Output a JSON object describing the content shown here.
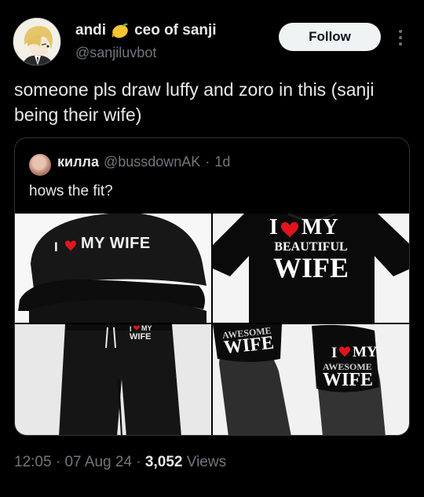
{
  "author": {
    "display_name": "andi",
    "name_suffix": "ceo of sanji",
    "handle": "@sanjiluvbot",
    "emoji": "lemon-icon"
  },
  "follow_label": "Follow",
  "tweet_text": "someone pls draw luffy and zoro in this (sanji being their wife)",
  "quote": {
    "display_name": "килла",
    "handle": "@bussdownAK",
    "separator": "·",
    "time": "1d",
    "text": "hows the fit?",
    "images": {
      "cap": {
        "line1": "MY WIFE"
      },
      "tshirt": {
        "line1": "MY",
        "line2": "BEAUTIFUL",
        "line3": "WIFE"
      },
      "pants": {
        "line1": "MY",
        "line2": "WIFE"
      },
      "slides": {
        "left_arch": "AWESOME",
        "left_word": "WIFE",
        "right_line1": "MY",
        "right_arch": "AWESOME",
        "right_word": "WIFE"
      }
    }
  },
  "footer": {
    "time": "12:05",
    "sep1": "·",
    "date": "07 Aug 24",
    "sep2": "·",
    "views_count": "3,052",
    "views_label": "Views"
  },
  "colors": {
    "heart": "#e0151d",
    "muted": "#71767b",
    "text": "#e7e9ea",
    "border": "#2f3336"
  }
}
